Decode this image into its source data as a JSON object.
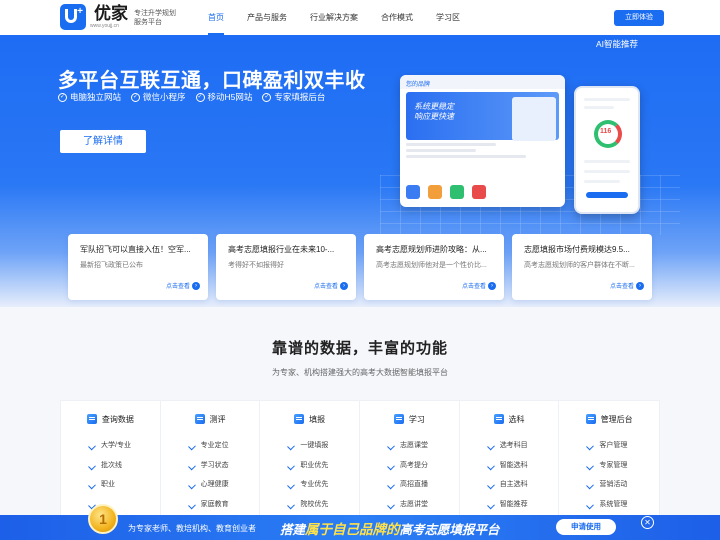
{
  "header": {
    "brand": "优家",
    "brand_url": "www.youjj.cn",
    "slogan_line1": "专注升学规划",
    "slogan_line2": "服务平台",
    "nav": [
      "首页",
      "产品与服务",
      "行业解决方案",
      "合作模式",
      "学习区"
    ],
    "try_label": "立即体验"
  },
  "hero": {
    "title": "多平台互联互通，口碑盈利双丰收",
    "features": [
      "电脑独立网站",
      "微信小程序",
      "移动H5网站",
      "专家填报后台"
    ],
    "detail_label": "了解详情",
    "ai_label": "AI智能推荐",
    "mock_brand": "您的品牌",
    "mock_banner_line1": "系统更稳定",
    "mock_banner_line2": "响应更快速",
    "mock_score": "116"
  },
  "news": [
    {
      "title": "军队招飞可以直接入伍！空军...",
      "desc": "最新招飞政策已公布",
      "link": "点击查看"
    },
    {
      "title": "高考志愿填报行业在未来10-...",
      "desc": "考得好不如报得好",
      "link": "点击查看"
    },
    {
      "title": "高考志愿规划师进阶攻略：从...",
      "desc": "高考志愿规划师他对是一个性价比...",
      "link": "点击查看"
    },
    {
      "title": "志愿填报市场付费规模达9.5...",
      "desc": "高考志愿规划师的客户群体在不断...",
      "link": "点击查看"
    }
  ],
  "section": {
    "title": "靠谱的数据，丰富的功能",
    "subtitle": "为专家、机构搭建强大的高考大数据智能填报平台"
  },
  "features_grid": [
    {
      "head": "查询数据",
      "items": [
        "大学/专业",
        "批次线",
        "职业",
        "..."
      ]
    },
    {
      "head": "测评",
      "items": [
        "专业定位",
        "学习状态",
        "心理健康",
        "家庭教育"
      ]
    },
    {
      "head": "填报",
      "items": [
        "一键填报",
        "职业优先",
        "专业优先",
        "院校优先"
      ]
    },
    {
      "head": "学习",
      "items": [
        "志愿课堂",
        "高考提分",
        "高招直播",
        "志愿讲堂"
      ]
    },
    {
      "head": "选科",
      "items": [
        "选考科目",
        "智能选科",
        "自主选科",
        "智能推荐"
      ]
    },
    {
      "head": "管理后台",
      "items": [
        "客户管理",
        "专家管理",
        "营销活动",
        "系统管理"
      ]
    }
  ],
  "promo": {
    "medal": "1",
    "left_text": "为专家老师、教培机构、教育创业者",
    "main_pre": "搭建",
    "main_hl": "属于自己品牌的",
    "main_post": "高考志愿填报平台",
    "apply_label": "申请使用"
  },
  "icons": {
    "check": "check-circle-icon",
    "arrow": "arrow-right-icon",
    "close": "close-icon"
  },
  "colors": {
    "primary": "#1a6cf0",
    "highlight": "#ffe14a"
  }
}
